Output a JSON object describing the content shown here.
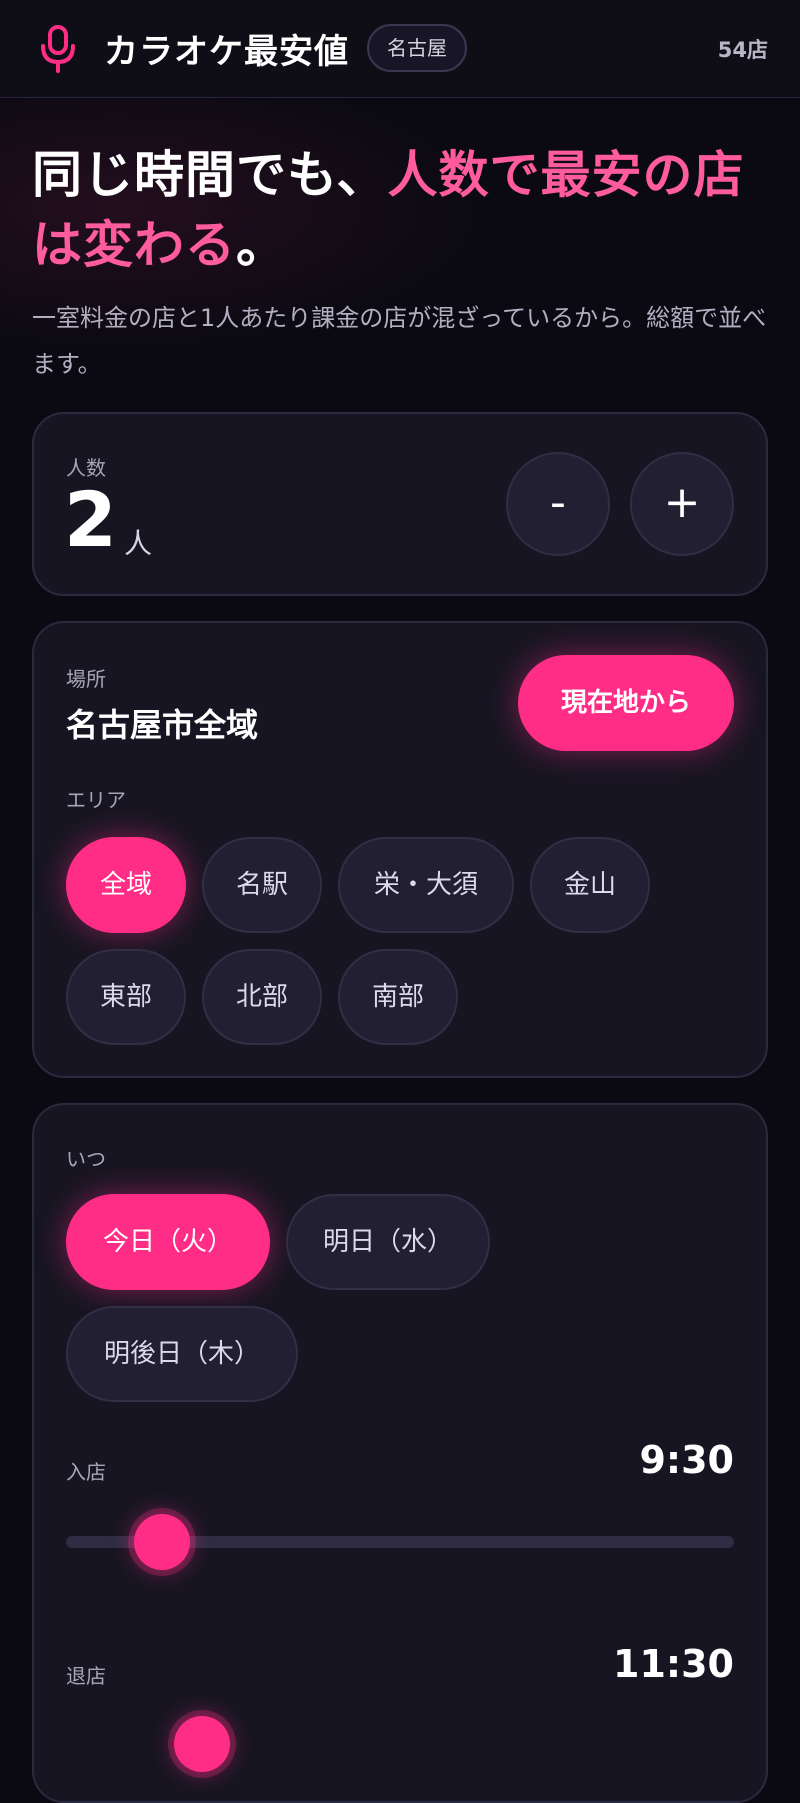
{
  "header": {
    "app_title": "カラオケ最安値",
    "city": "名古屋",
    "store_count": "54店",
    "icon": "microphone-icon"
  },
  "hero": {
    "headline_plain": "同じ時間でも、",
    "headline_pink": "人数で最安の店は変わる",
    "headline_end": "。",
    "subtext": "一室料金の店と1人あたり課金の店が混ざっているから。総額で並べます。"
  },
  "people": {
    "label": "人数",
    "value": "2",
    "unit": "人",
    "minus_label": "-",
    "plus_label": "+"
  },
  "place": {
    "label": "場所",
    "value": "名古屋市全域",
    "locate_button": "現在地から",
    "area_label": "エリア",
    "areas": [
      {
        "label": "全域",
        "active": true
      },
      {
        "label": "名駅",
        "active": false
      },
      {
        "label": "栄・大須",
        "active": false
      },
      {
        "label": "金山",
        "active": false
      },
      {
        "label": "東部",
        "active": false
      },
      {
        "label": "北部",
        "active": false
      },
      {
        "label": "南部",
        "active": false
      }
    ]
  },
  "when": {
    "label": "いつ",
    "days": [
      {
        "label": "今日（火）",
        "active": true
      },
      {
        "label": "明日（水）",
        "active": false
      },
      {
        "label": "明後日（木）",
        "active": false
      }
    ],
    "checkin_label": "入店",
    "checkin_time": "9:30",
    "checkout_label": "退店",
    "checkout_time": "11:30"
  },
  "colors": {
    "accent": "#ff2d86",
    "accent_text": "#ff5c9e",
    "background": "#0b0a12",
    "card": "#171522"
  }
}
